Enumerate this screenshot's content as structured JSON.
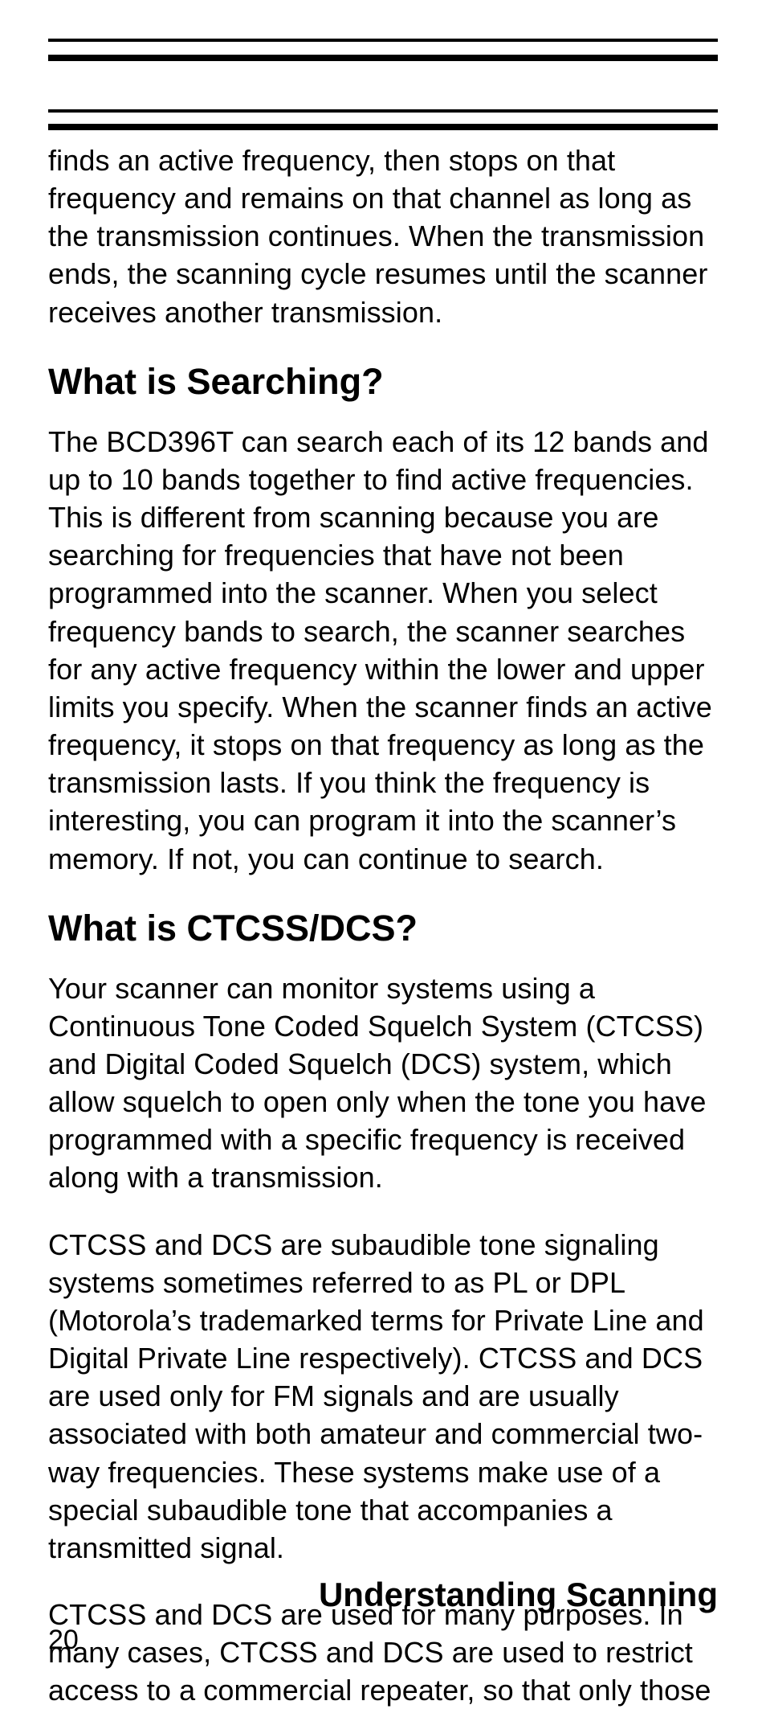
{
  "intro_continued": "finds an active frequency, then stops on that frequency and remains on that channel as long as the transmission continues. When the transmission ends, the scanning cycle resumes until the scanner receives another transmission.",
  "h_searching": "What is Searching?",
  "p_searching": "The BCD396T can search each of its 12 bands and up to 10 bands together to find active frequencies. This is different from scanning because you are searching for frequencies that have not been programmed into the scanner. When you select frequency bands to search, the scanner searches for any active frequency within the lower and upper limits you specify. When the scan­ner finds an active frequency, it stops on that fre­quency as long as the transmission lasts. If you think the frequency is interesting, you can program it into the scanner’s memory. If not, you can continue to search.",
  "h_ctcss": "What is CTCSS/DCS?",
  "p_ctcss_1": "Your scanner can monitor systems using a Continuous Tone Coded Squelch System (CTCSS) and Digital Coded Squelch (DCS) system, which allow squelch to open only when the tone you have programmed with a specific frequency is received along with a transmission.",
  "p_ctcss_2": "CTCSS and DCS are subaudible tone signaling systems sometimes referred to as PL or DPL (Motorola’s trademarked terms for Private Line and Digital Private Line respectively). CTCSS and DCS are used only for FM signals and are usually associated with both amateur and commercial two-way frequencies. These systems make use of a special subaudible tone that accompanies a transmitted signal.",
  "p_ctcss_3": "CTCSS and DCS are used for many purposes. In many cases, CTCSS and DCS are used to restrict access to a commercial repeater, so that only those",
  "section_title": "Understanding Scanning",
  "page_number": "20"
}
